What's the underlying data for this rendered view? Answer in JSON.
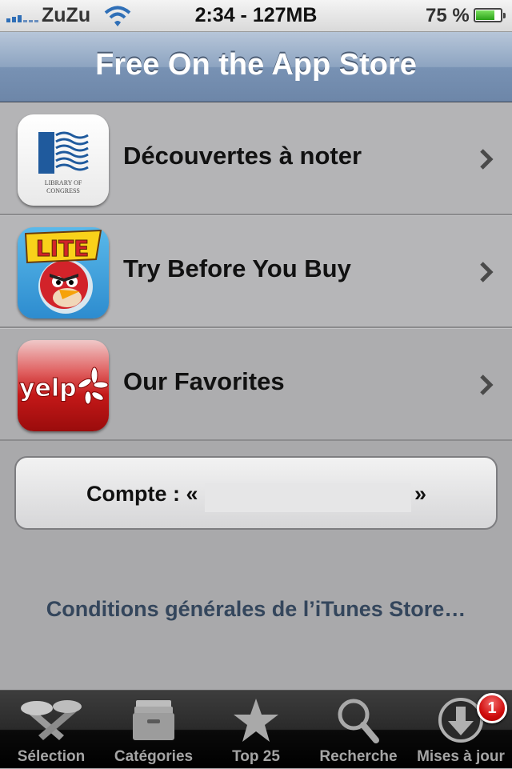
{
  "status_bar": {
    "carrier": "ZuZu",
    "time": "2:34 - 127MB",
    "battery": "75 %",
    "battery_level": 0.75
  },
  "navbar": {
    "title": "Free On the App Store"
  },
  "list": [
    {
      "label": "Découvertes à noter",
      "icon": "library-of-congress-icon",
      "icon_text": "LIBRARY OF CONGRESS"
    },
    {
      "label": "Try Before You Buy",
      "icon": "angry-birds-lite-icon",
      "icon_text": "LITE"
    },
    {
      "label": "Our Favorites",
      "icon": "yelp-icon",
      "icon_text": "yelp"
    }
  ],
  "account": {
    "label": "Compte : «",
    "closing": "»"
  },
  "terms_link": "Conditions générales de l’iTunes Store…",
  "tabbar": {
    "tabs": [
      {
        "label": "Sélection",
        "icon": "featured-icon"
      },
      {
        "label": "Catégories",
        "icon": "categories-icon"
      },
      {
        "label": "Top 25",
        "icon": "star-icon"
      },
      {
        "label": "Recherche",
        "icon": "search-icon"
      },
      {
        "label": "Mises à jour",
        "icon": "download-icon"
      }
    ],
    "badge": "1"
  },
  "colors": {
    "nav": "#7892b4",
    "tab_label": "#a5a5a5",
    "link": "#34465c",
    "badge": "#d00d0d"
  }
}
